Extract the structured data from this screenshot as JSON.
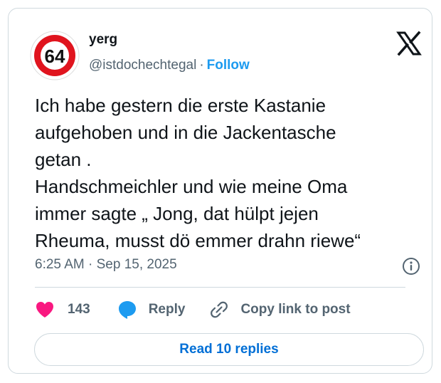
{
  "author": {
    "display_name": "yerg",
    "handle": "@istdochechtegal",
    "follow_label": "Follow",
    "avatar_text": "64"
  },
  "tweet": {
    "text": "Ich habe gestern die erste Kastanie\naufgehoben und in die Jackentasche\ngetan .\nHandschmeichler und wie meine Oma\nimmer sagte „ Jong, dat hülpt jejen\nRheuma, musst dö emmer drahn riewe“",
    "time": "6:25 AM",
    "date": "Sep 15, 2025"
  },
  "actions": {
    "like_count": "143",
    "reply_label": "Reply",
    "copy_link_label": "Copy link to post"
  },
  "read_replies_label": "Read 10 replies",
  "colors": {
    "accent": "#1d9bf0",
    "like": "#f91880",
    "read_button_text": "#006fd6",
    "avatar_ring": "#e0141e"
  },
  "icons": {
    "logo": "x-logo-icon",
    "info": "info-icon",
    "like": "heart-icon",
    "reply": "speech-bubble-icon",
    "copy": "link-icon"
  }
}
